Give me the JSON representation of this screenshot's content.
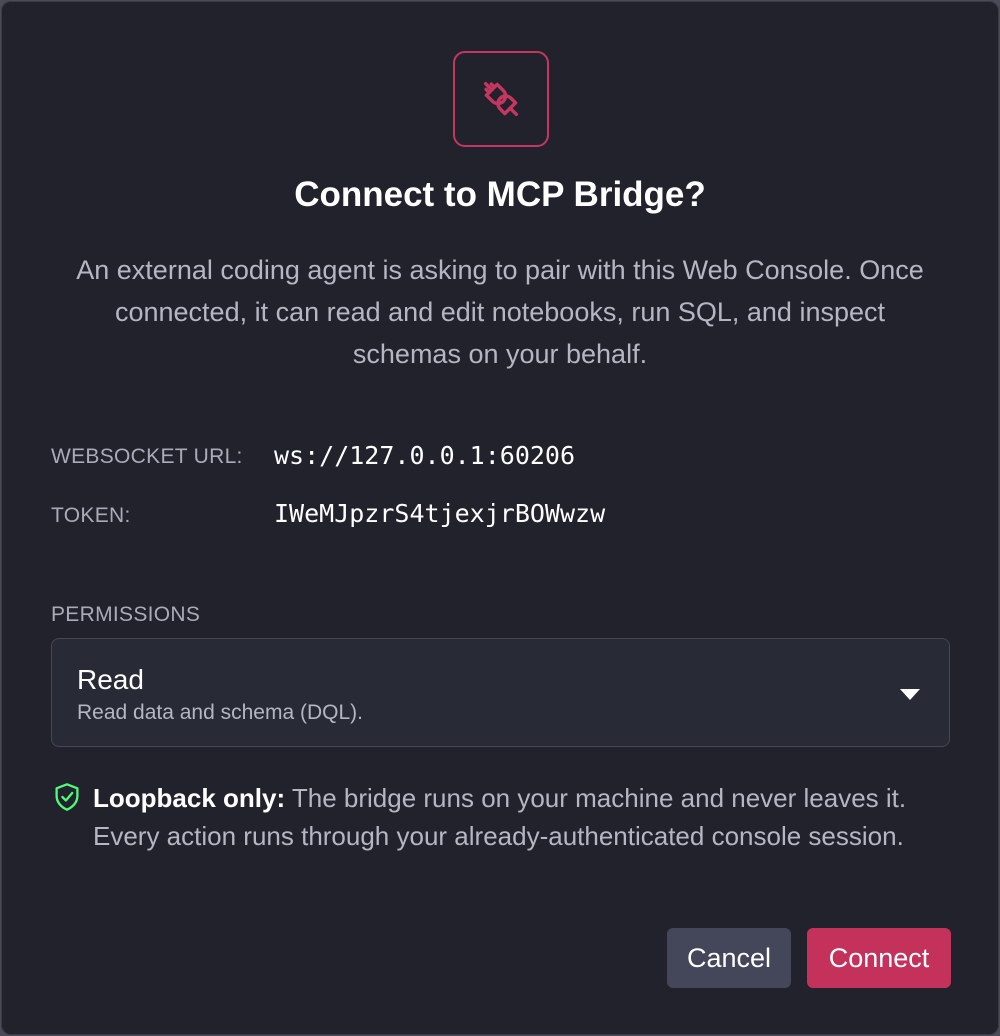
{
  "dialog": {
    "icon": "plug-icon",
    "title": "Connect to MCP Bridge?",
    "description": "An external coding agent is asking to pair with this Web Console. Once connected, it can read and edit notebooks, run SQL, and inspect schemas on your behalf.",
    "fields": [
      {
        "label": "WEBSOCKET URL:",
        "value": "ws://127.0.0.1:60206"
      },
      {
        "label": "TOKEN:",
        "value": "IWeMJpzrS4tjexjrBOWwzw"
      }
    ],
    "permissions": {
      "label": "PERMISSIONS",
      "selected_title": "Read",
      "selected_description": "Read data and schema (DQL)."
    },
    "note": {
      "icon": "shield-check-icon",
      "bold": "Loopback only:",
      "text": " The bridge runs on your machine and never leaves it. Every action runs through your already-authenticated console session."
    },
    "buttons": {
      "cancel": "Cancel",
      "connect": "Connect"
    },
    "colors": {
      "background": "#21222c",
      "accent": "#c4325c",
      "shield": "#50fa7b",
      "secondary_button": "#44475a"
    }
  }
}
